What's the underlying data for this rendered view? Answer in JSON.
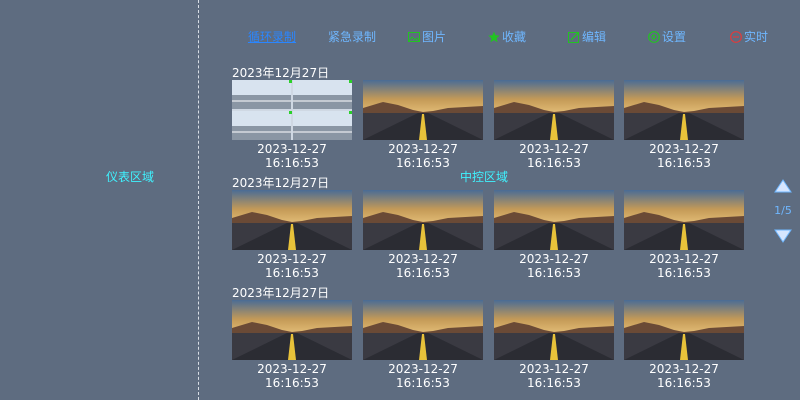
{
  "sidebar": {
    "label": "仪表区域"
  },
  "center": {
    "label": "中控区域"
  },
  "tabs": [
    {
      "label": "循环录制",
      "icon": "",
      "active": true
    },
    {
      "label": "紧急录制",
      "icon": ""
    },
    {
      "label": "图片",
      "icon": "image-icon"
    },
    {
      "label": "收藏",
      "icon": "star-icon"
    },
    {
      "label": "编辑",
      "icon": "edit-icon"
    },
    {
      "label": "设置",
      "icon": "settings-icon"
    },
    {
      "label": "实时",
      "icon": "live-icon"
    }
  ],
  "sections": [
    {
      "date": "2023年12月27日",
      "items": [
        "2023-12-27 16:16:53",
        "2023-12-27 16:16:53",
        "2023-12-27 16:16:53",
        "2023-12-27 16:16:53"
      ]
    },
    {
      "date": "2023年12月27日",
      "items": [
        "2023-12-27 16:16:53",
        "2023-12-27 16:16:53",
        "2023-12-27 16:16:53",
        "2023-12-27 16:16:53"
      ]
    },
    {
      "date": "2023年12月27日",
      "items": [
        "2023-12-27 16:16:53",
        "2023-12-27 16:16:53",
        "2023-12-27 16:16:53",
        "2023-12-27 16:16:53"
      ]
    }
  ],
  "pager": {
    "page": "1/5"
  },
  "colors": {
    "tab": "#6fb7ff",
    "tab_active": "#2a86ff",
    "cyan": "#3ff3ff",
    "star": "#22c322",
    "live": "#e03b3b"
  }
}
